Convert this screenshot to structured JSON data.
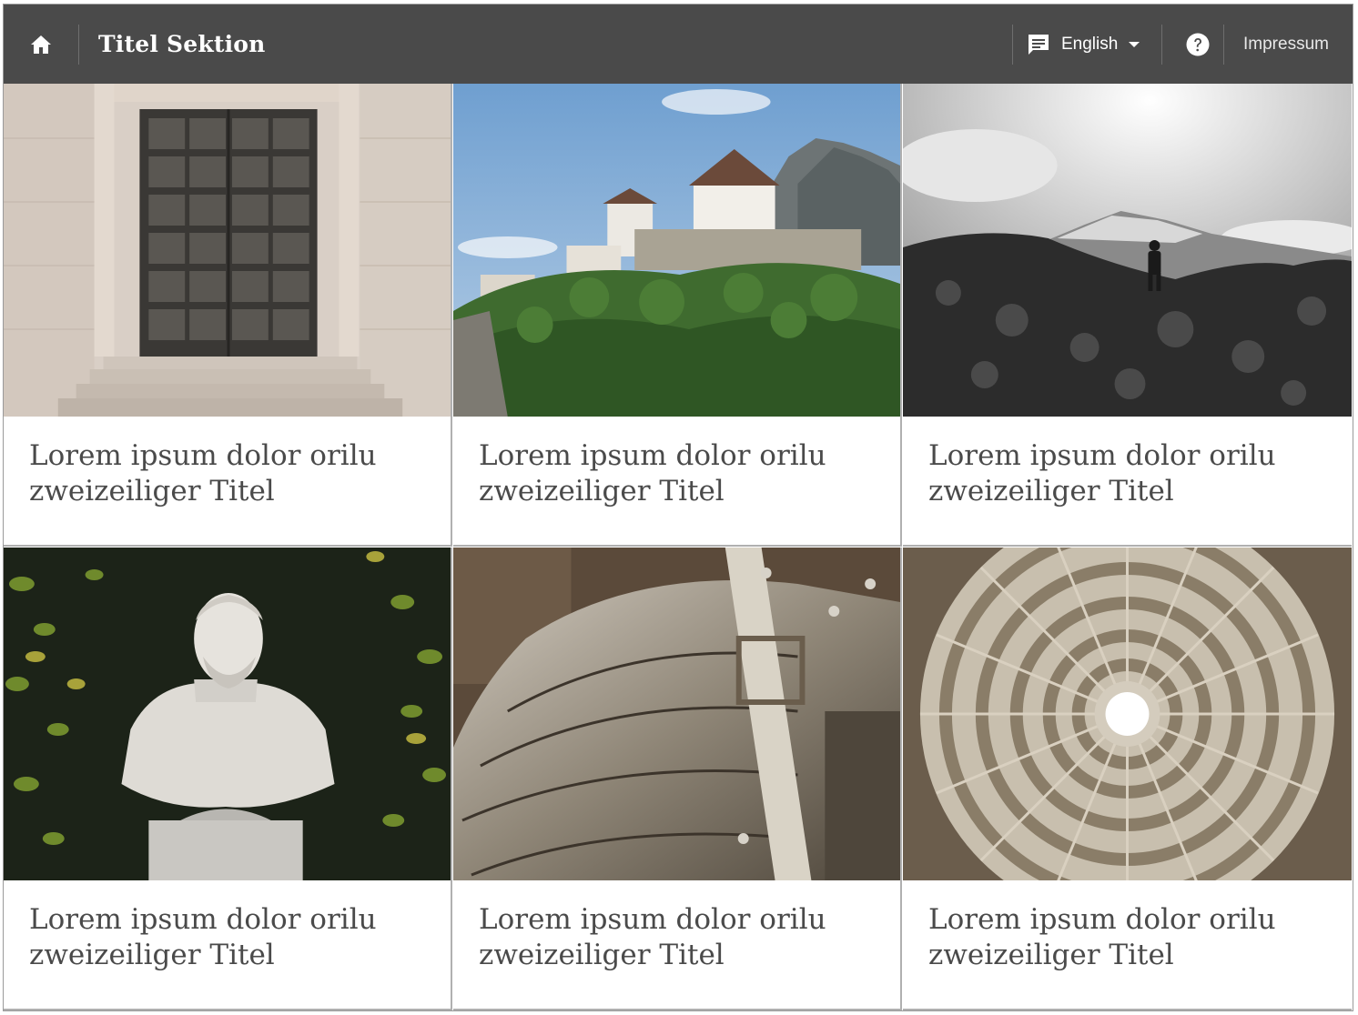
{
  "header": {
    "home_icon": "home-icon",
    "title": "Titel Sektion",
    "language": {
      "icon": "chat-icon",
      "selected": "English",
      "caret_icon": "caret-down-icon"
    },
    "help_icon": "help-circle-icon",
    "impressum_label": "Impressum"
  },
  "cards": [
    {
      "image": "bronze-door",
      "title_line1": "Lorem ipsum dolor orilu",
      "title_line2": "zweizeiliger Titel"
    },
    {
      "image": "castle-hilltop",
      "title_line1": "Lorem ipsum dolor orilu",
      "title_line2": "zweizeiliger Titel"
    },
    {
      "image": "hiker-mountain",
      "title_line1": "Lorem ipsum dolor orilu",
      "title_line2": "zweizeiliger Titel"
    },
    {
      "image": "marble-bust",
      "title_line1": "Lorem ipsum dolor orilu",
      "title_line2": "zweizeiliger Titel"
    },
    {
      "image": "armor-plate",
      "title_line1": "Lorem ipsum dolor orilu",
      "title_line2": "zweizeiliger Titel"
    },
    {
      "image": "pantheon-dome",
      "title_line1": "Lorem ipsum dolor orilu",
      "title_line2": "zweizeiliger Titel"
    }
  ]
}
